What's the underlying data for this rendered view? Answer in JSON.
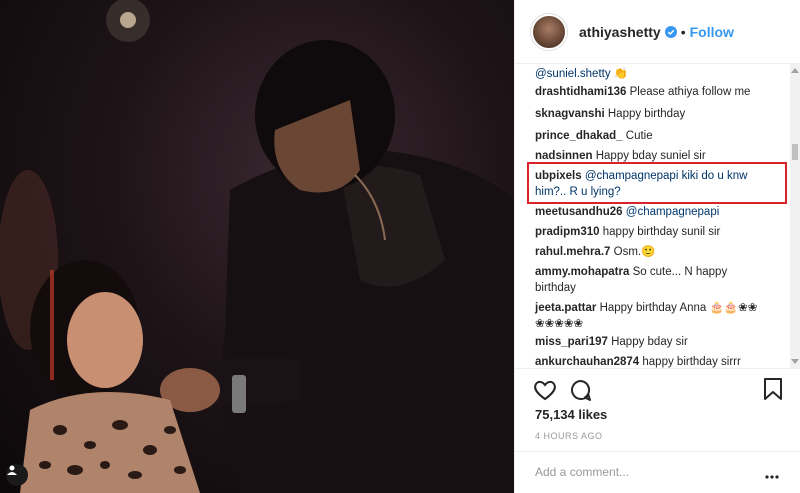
{
  "post": {
    "username": "athiyashetty",
    "follow_label": "Follow",
    "separator": "•",
    "likes": "75,134 likes",
    "time": "4 HOURS AGO",
    "add_comment_placeholder": "Add a comment...",
    "more_icon": "more-icon"
  },
  "comments": [
    {
      "user": "",
      "text": "@suniel.shetty 👏"
    },
    {
      "user": "drashtidhami136",
      "text": "Please athiya follow me"
    },
    {
      "user": "sknagvanshi",
      "text": "Happy birthday"
    },
    {
      "user": "prince_dhakad_",
      "text": "Cutie"
    },
    {
      "user": "nadsinnen",
      "text": "Happy bday suniel sir"
    },
    {
      "user": "ubpixels",
      "text": "@champagnepapi kiki do u knw him?.. R u lying?"
    },
    {
      "user": "meetusandhu26",
      "text": "@champagnepapi"
    },
    {
      "user": "pradipm310",
      "text": "happy birthday sunil sir"
    },
    {
      "user": "rahul.mehra.7",
      "text": "Osm.🙂"
    },
    {
      "user": "ammy.mohapatra",
      "text": "So cute... N happy birthday"
    },
    {
      "user": "jeeta.pattar",
      "text": "Happy birthday Anna 🎂🎂❀❀ ❀❀❀❀❀"
    },
    {
      "user": "miss_pari197",
      "text": "Happy bday sir"
    },
    {
      "user": "ankurchauhan2874",
      "text": "happy birthday sirrr"
    }
  ],
  "colors": {
    "accent": "#3897f0",
    "highlight": "#d9222a",
    "mention": "#003569"
  }
}
